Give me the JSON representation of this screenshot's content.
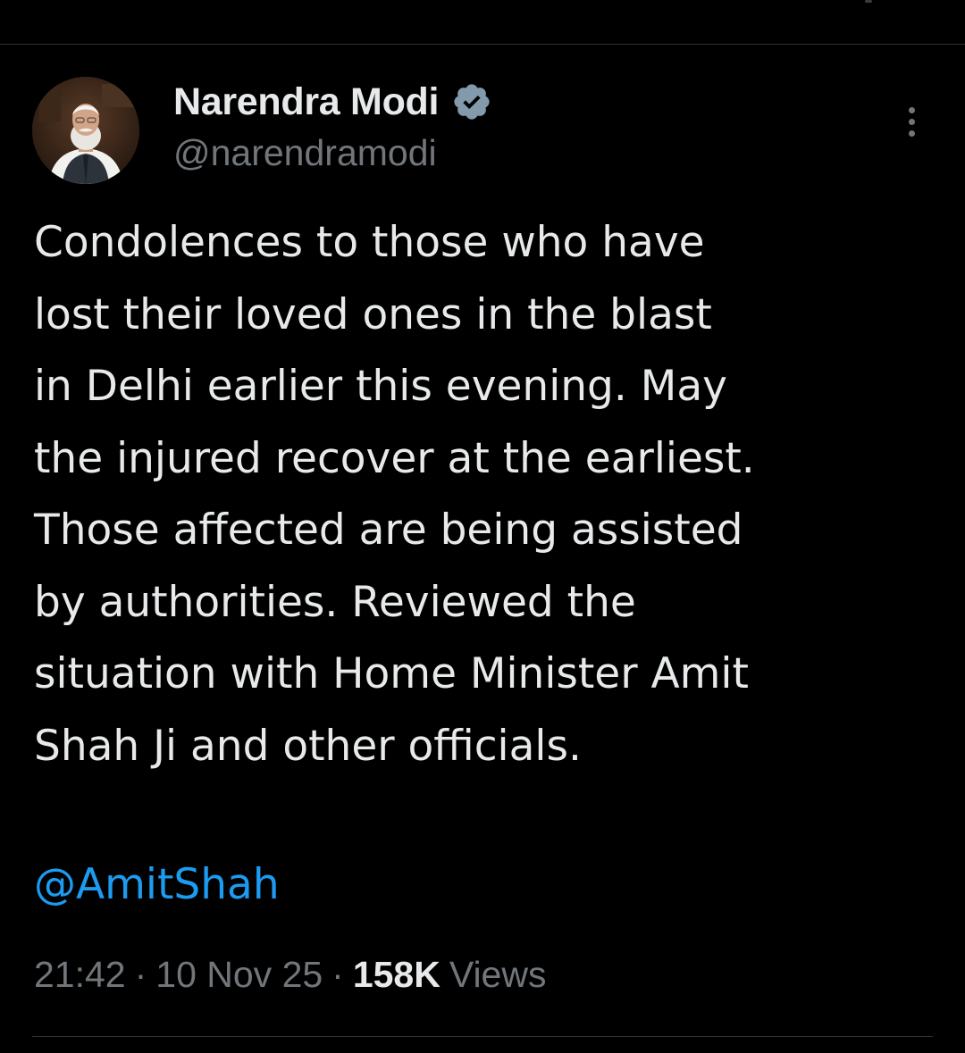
{
  "tweet": {
    "author": {
      "name": "Narendra Modi",
      "handle": "@narendramodi",
      "verified": true,
      "avatar_icon": "profile-photo"
    },
    "menu_icon": "more-vertical-icon",
    "text_lines": [
      "Condolences to those who have",
      "lost their loved ones in the blast",
      "in Delhi earlier this evening. May",
      "the injured recover at the earliest.",
      "Those affected are being assisted",
      "by authorities. Reviewed the",
      "situation with Home Minister Amit",
      "Shah Ji and other officials."
    ],
    "mention": "@AmitShah",
    "time": "21:42",
    "separator": "·",
    "date": "10 Nov 25",
    "views_count": "158K",
    "views_label": "Views"
  },
  "colors": {
    "background": "#000000",
    "text_primary": "#e7e9ea",
    "text_secondary": "#71767b",
    "link": "#1d9bf0",
    "divider": "#2f3336",
    "verified_badge": "#829aab"
  }
}
